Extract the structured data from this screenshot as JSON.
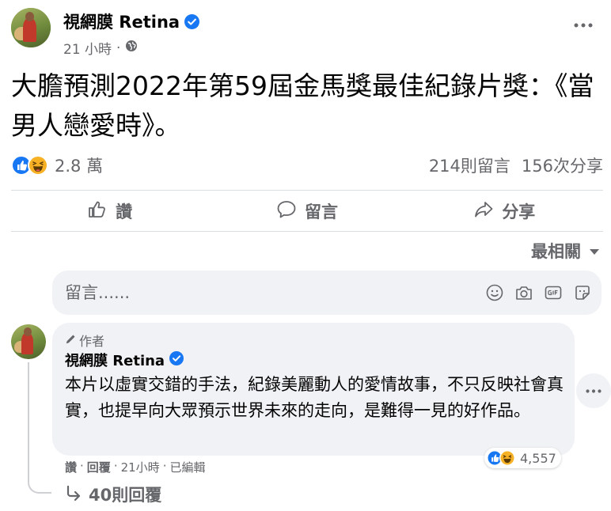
{
  "post": {
    "author": "視網膜 Retina",
    "time": "21 小時",
    "separator": "·",
    "text": "大膽預測2022年第59屆金馬獎最佳紀錄片獎：《當男人戀愛時》。",
    "reaction_count": "2.8 萬",
    "comments_count": "214則留言",
    "shares_count": "156次分享"
  },
  "actions": {
    "like": "讚",
    "comment": "留言",
    "share": "分享"
  },
  "sort": {
    "label": "最相關"
  },
  "comment_box": {
    "placeholder": "留言......"
  },
  "comment": {
    "author_tag": "作者",
    "author": "視網膜 Retina",
    "text": "本片以虛實交錯的手法，紀錄美麗動人的愛情故事，不只反映社會真實，也提早向大眾預示世界未來的走向，是難得一見的好作品。",
    "reaction_count": "4,557",
    "like_label": "讚",
    "reply_label": "回覆",
    "time": "21小時",
    "edited": "已編輯",
    "dot": "·",
    "replies": "40則回覆"
  },
  "colors": {
    "verified_blue": "#1877f2",
    "like_blue": "#1877f2",
    "haha_yellow": "#f7b125",
    "secondary_text": "#65676b",
    "bubble_bg": "#f0f2f5"
  }
}
